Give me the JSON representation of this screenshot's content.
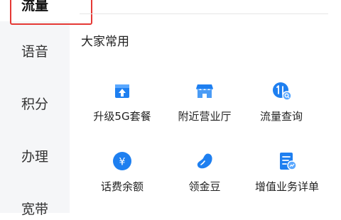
{
  "sidebar": {
    "items": [
      {
        "label": "流量",
        "active": true
      },
      {
        "label": "语音",
        "active": false
      },
      {
        "label": "积分",
        "active": false
      },
      {
        "label": "办理",
        "active": false
      },
      {
        "label": "宽带",
        "active": false
      }
    ]
  },
  "main": {
    "section_title": "大家常用",
    "services": [
      {
        "label": "升级5G套餐",
        "icon": "upgrade-icon"
      },
      {
        "label": "附近营业厅",
        "icon": "store-icon"
      },
      {
        "label": "流量查询",
        "icon": "data-query-icon"
      },
      {
        "label": "话费余额",
        "icon": "yuan-icon"
      },
      {
        "label": "领金豆",
        "icon": "bean-icon"
      },
      {
        "label": "增值业务详单",
        "icon": "document-icon"
      }
    ]
  },
  "colors": {
    "accent_blue": "#1e7ff0",
    "highlight_red": "#e53935",
    "sidebar_bg": "#f5f6f8"
  }
}
